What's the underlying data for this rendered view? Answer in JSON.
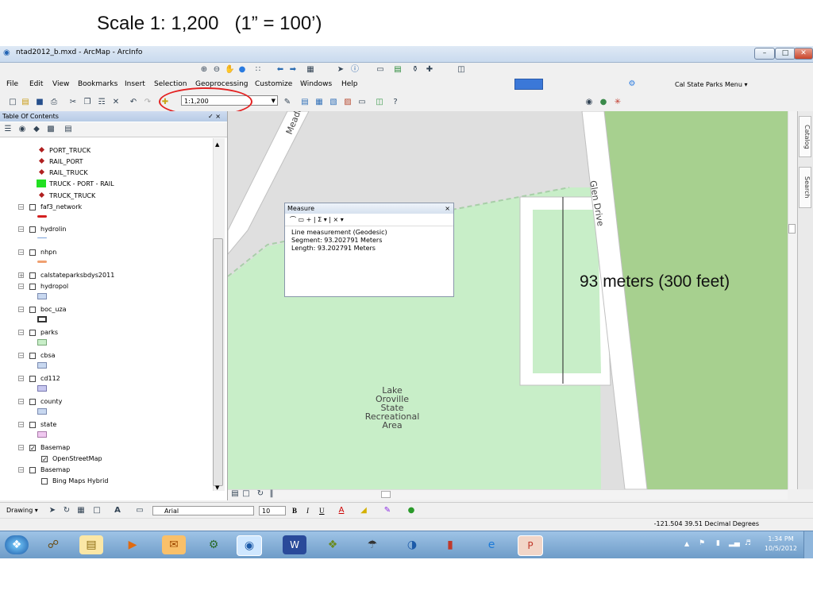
{
  "slide": {
    "title": "Scale 1: 1,200   (1” = 100’)"
  },
  "window": {
    "title": "ntad2012_b.mxd - ArcMap - ArcInfo",
    "minimize": "–",
    "maximize": "□",
    "close": "✕"
  },
  "menu": [
    "File",
    "Edit",
    "View",
    "Bookmarks",
    "Insert",
    "Selection",
    "Geoprocessing",
    "Customize",
    "Windows",
    "Help"
  ],
  "toolbar": {
    "scale": "1:1,200",
    "cal_state_parks_menu": "Cal State Parks Menu ▾"
  },
  "toc": {
    "title": "Table Of Contents",
    "pin": "✓ ×",
    "items": [
      {
        "label": "PORT_TRUCK",
        "sym": "dot-red"
      },
      {
        "label": "RAIL_PORT",
        "sym": "dot-red"
      },
      {
        "label": "RAIL_TRUCK",
        "sym": "dot-red"
      },
      {
        "label": "TRUCK - PORT - RAIL",
        "sym": "square-green"
      },
      {
        "label": "TRUCK_TRUCK",
        "sym": "dot-red"
      },
      {
        "label": "faf3_network",
        "check": false,
        "sym": "line-red"
      },
      {
        "label": "hydrolin",
        "check": false,
        "sym": "line-blue"
      },
      {
        "label": "nhpn",
        "check": false,
        "sym": "line-orange"
      },
      {
        "label": "calstateparksbdys2011",
        "check": false
      },
      {
        "label": "hydropol",
        "check": false,
        "sym": "fill-lightblue"
      },
      {
        "label": "boc_uza",
        "check": false,
        "sym": "fill-outline"
      },
      {
        "label": "parks",
        "check": false,
        "sym": "fill-green"
      },
      {
        "label": "cbsa",
        "check": false,
        "sym": "fill-lightblue"
      },
      {
        "label": "cd112",
        "check": false,
        "sym": "fill-lavender"
      },
      {
        "label": "county",
        "check": false,
        "sym": "fill-lightblue"
      },
      {
        "label": "state",
        "check": false,
        "sym": "fill-pink"
      },
      {
        "label": "Basemap",
        "check": true
      },
      {
        "label": "OpenStreetMap",
        "check": true
      },
      {
        "label": "Basemap",
        "check": false
      },
      {
        "label": "Bing Maps Hybrid",
        "check": false
      }
    ]
  },
  "measure": {
    "title": "Measure",
    "close": "×",
    "tools": "⌒ ▭ + | Σ ▾ | × ▾",
    "type": "Line measurement (Geodesic)",
    "segment": "Segment: 93.202791 Meters",
    "length": "Length: 93.202791 Meters"
  },
  "map": {
    "street_meadow": "Meado",
    "street_glen": "Glen Drive",
    "park_label": [
      "Lake",
      "Oroville",
      "State",
      "Recreational",
      "Area"
    ]
  },
  "annotation": "93 meters (300 feet)",
  "dock": {
    "catalog": "Catalog",
    "search": "Search"
  },
  "drawing": {
    "label": "Drawing ▾",
    "font": "Arial",
    "size": "10",
    "bold": "B",
    "italic": "I",
    "underline": "U"
  },
  "status": {
    "coords": "-121.504  39.51 Decimal Degrees"
  },
  "clock": {
    "time": "1:34 PM",
    "date": "10/5/2012"
  },
  "colors": {
    "park": "#c8eec8",
    "grass": "#a7d08f",
    "road": "#ffffff",
    "road_edge": "#c0c0c0",
    "annotation_ellipse": "#e32222"
  }
}
